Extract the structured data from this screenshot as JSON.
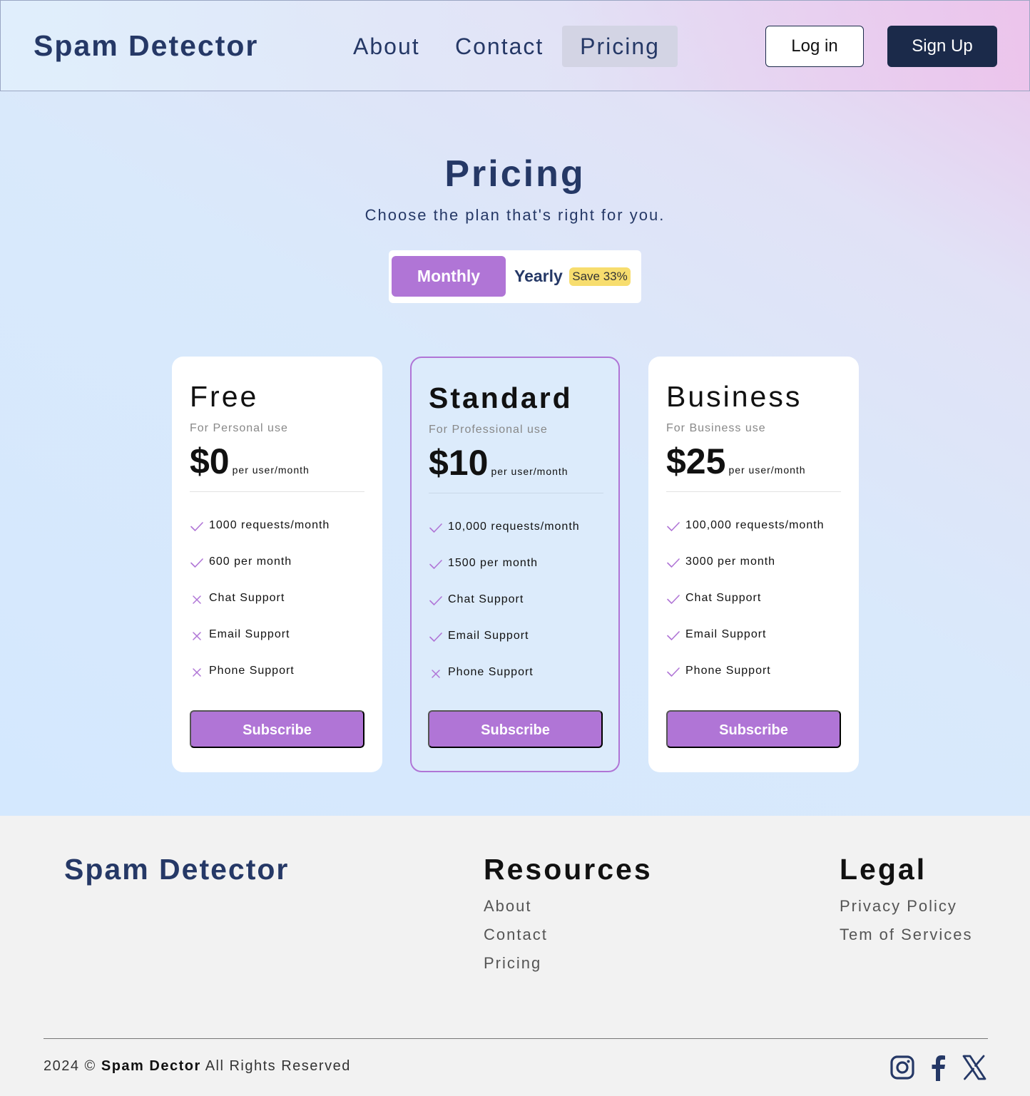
{
  "header": {
    "logo": "Spam Detector",
    "nav": [
      {
        "label": "About"
      },
      {
        "label": "Contact"
      },
      {
        "label": "Pricing",
        "active": true
      }
    ],
    "login_label": "Log in",
    "signup_label": "Sign Up"
  },
  "hero": {
    "title": "Pricing",
    "subtitle": "Choose the plan that's right for you."
  },
  "billing_toggle": {
    "monthly_label": "Monthly",
    "yearly_label": "Yearly",
    "save_badge": "Save 33%",
    "selected": "Monthly"
  },
  "plans": [
    {
      "name": "Free",
      "description": "For Personal use",
      "price": "$0",
      "price_unit": "per user/month",
      "features": [
        {
          "text": "1000 requests/month",
          "included": true
        },
        {
          "text": "600 per month",
          "included": true
        },
        {
          "text": "Chat Support",
          "included": false
        },
        {
          "text": "Email Support",
          "included": false
        },
        {
          "text": "Phone Support",
          "included": false
        }
      ],
      "cta": "Subscribe"
    },
    {
      "name": "Standard",
      "description": "For Professional use",
      "price": "$10",
      "price_unit": "per user/month",
      "featured": true,
      "features": [
        {
          "text": "10,000 requests/month",
          "included": true
        },
        {
          "text": "1500 per month",
          "included": true
        },
        {
          "text": "Chat Support",
          "included": true
        },
        {
          "text": "Email Support",
          "included": true
        },
        {
          "text": "Phone Support",
          "included": false
        }
      ],
      "cta": "Subscribe"
    },
    {
      "name": "Business",
      "description": "For Business use",
      "price": "$25",
      "price_unit": "per user/month",
      "features": [
        {
          "text": "100,000 requests/month",
          "included": true
        },
        {
          "text": "3000 per month",
          "included": true
        },
        {
          "text": "Chat Support",
          "included": true
        },
        {
          "text": "Email Support",
          "included": true
        },
        {
          "text": "Phone Support",
          "included": true
        }
      ],
      "cta": "Subscribe"
    }
  ],
  "footer": {
    "logo": "Spam Detector",
    "resources": {
      "title": "Resources",
      "links": [
        "About",
        "Contact",
        "Pricing"
      ]
    },
    "legal": {
      "title": "Legal",
      "links": [
        "Privacy Policy",
        "Tem of Services"
      ]
    },
    "copyright_prefix": "2024 ©",
    "copyright_brand": "Spam Dector",
    "copyright_suffix": "All Rights Reserved",
    "social": [
      "instagram-icon",
      "facebook-icon",
      "x-icon"
    ]
  },
  "colors": {
    "brand_navy": "#253866",
    "button_dark": "#1b2a4a",
    "accent_purple": "#b075d6",
    "badge_yellow": "#f7dd6e"
  }
}
